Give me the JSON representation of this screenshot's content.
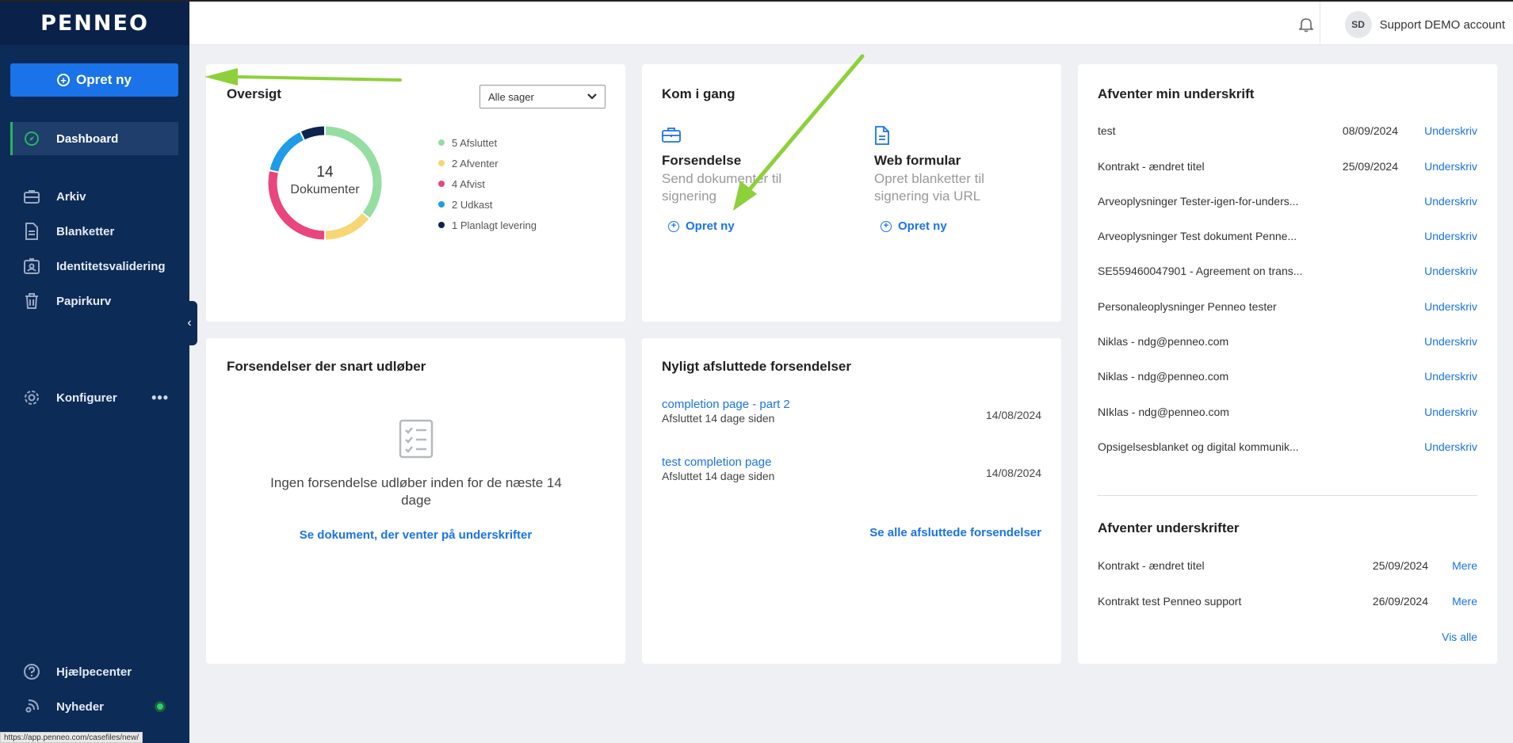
{
  "sidebar": {
    "logo": "PENNEO",
    "create_label": "Opret ny",
    "items": [
      {
        "label": "Dashboard"
      },
      {
        "label": "Arkiv"
      },
      {
        "label": "Blanketter"
      },
      {
        "label": "Identitetsvalidering"
      },
      {
        "label": "Papirkurv"
      },
      {
        "label": "Konfigurer"
      },
      {
        "label": "Hjælpecenter"
      },
      {
        "label": "Nyheder"
      }
    ],
    "more_dots": "•••",
    "status_url": "https://app.penneo.com/casefiles/new/"
  },
  "header": {
    "avatar_initials": "SD",
    "account_name": "Support DEMO account"
  },
  "overview": {
    "title": "Oversigt",
    "filter_value": "Alle sager",
    "total": "14",
    "total_label": "Dokumenter",
    "legend": [
      {
        "label": "5 Afsluttet",
        "color": "#95dea2"
      },
      {
        "label": "2 Afventer",
        "color": "#f7d774"
      },
      {
        "label": "4 Afvist",
        "color": "#e8467c"
      },
      {
        "label": "2 Udkast",
        "color": "#1e9be9"
      },
      {
        "label": "1 Planlagt levering",
        "color": "#0d2450"
      }
    ]
  },
  "chart_data": {
    "type": "pie",
    "categories": [
      "Afsluttet",
      "Afventer",
      "Afvist",
      "Udkast",
      "Planlagt levering"
    ],
    "values": [
      5,
      2,
      4,
      2,
      1
    ],
    "colors": [
      "#95dea2",
      "#f7d774",
      "#e8467c",
      "#1e9be9",
      "#0d2450"
    ],
    "title": "Oversigt"
  },
  "get_started": {
    "title": "Kom i gang",
    "cols": [
      {
        "title": "Forsendelse",
        "desc": "Send dokumenter til signering",
        "btn": "Opret ny",
        "icon": "briefcase-icon"
      },
      {
        "title": "Web formular",
        "desc": "Opret blanketter til signering via URL",
        "btn": "Opret ny",
        "icon": "document-icon"
      }
    ]
  },
  "awaiting_me": {
    "title": "Afventer min underskrift",
    "rows": [
      {
        "name": "test",
        "date": "08/09/2024",
        "action": "Underskriv"
      },
      {
        "name": "Kontrakt - ændret titel",
        "date": "25/09/2024",
        "action": "Underskriv"
      },
      {
        "name": "Arveoplysninger Tester-igen-for-unders...",
        "date": "",
        "action": "Underskriv"
      },
      {
        "name": "Arveoplysninger Test dokument Penne...",
        "date": "",
        "action": "Underskriv"
      },
      {
        "name": "SE559460047901 - Agreement on trans...",
        "date": "",
        "action": "Underskriv"
      },
      {
        "name": "Personaleoplysninger Penneo tester",
        "date": "",
        "action": "Underskriv"
      },
      {
        "name": "Niklas - ndg@penneo.com",
        "date": "",
        "action": "Underskriv"
      },
      {
        "name": "Niklas - ndg@penneo.com",
        "date": "",
        "action": "Underskriv"
      },
      {
        "name": "NIklas - ndg@penneo.com",
        "date": "",
        "action": "Underskriv"
      },
      {
        "name": "Opsigelsesblanket og digital kommunik...",
        "date": "",
        "action": "Underskriv"
      }
    ]
  },
  "awaiting_signatures": {
    "title": "Afventer underskrifter",
    "rows": [
      {
        "name": "Kontrakt - ændret titel",
        "date": "25/09/2024",
        "action": "Mere"
      },
      {
        "name": "Kontrakt test Penneo support",
        "date": "26/09/2024",
        "action": "Mere"
      }
    ],
    "view_all": "Vis alle"
  },
  "expiring": {
    "title": "Forsendelser der snart udløber",
    "empty_text": "Ingen forsendelse udløber inden for de næste 14 dage",
    "link": "Se dokument, der venter på underskrifter"
  },
  "recent": {
    "title": "Nyligt afsluttede forsendelser",
    "items": [
      {
        "title": "completion page - part 2",
        "sub": "Afsluttet 14 dage siden",
        "date": "14/08/2024"
      },
      {
        "title": "test completion page",
        "sub": "Afsluttet 14 dage siden",
        "date": "14/08/2024"
      }
    ],
    "link": "Se alle afsluttede forsendelser"
  }
}
